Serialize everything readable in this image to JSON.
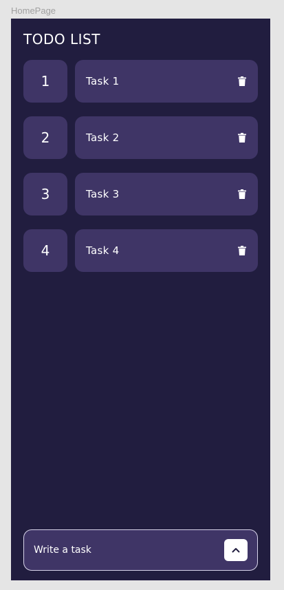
{
  "frame": {
    "label": "HomePage"
  },
  "header": {
    "title": "TODO LIST"
  },
  "tasks": [
    {
      "number": "1",
      "label": "Task 1"
    },
    {
      "number": "2",
      "label": "Task 2"
    },
    {
      "number": "3",
      "label": "Task 3"
    },
    {
      "number": "4",
      "label": "Task 4"
    }
  ],
  "icons": {
    "delete": "trash-icon",
    "submit": "chevron-up-icon"
  },
  "composer": {
    "placeholder": "Write a task",
    "value": ""
  },
  "colors": {
    "background": "#211d3f",
    "card": "#3f3566",
    "text": "#ffffff",
    "canvas": "#e5e5e5"
  }
}
